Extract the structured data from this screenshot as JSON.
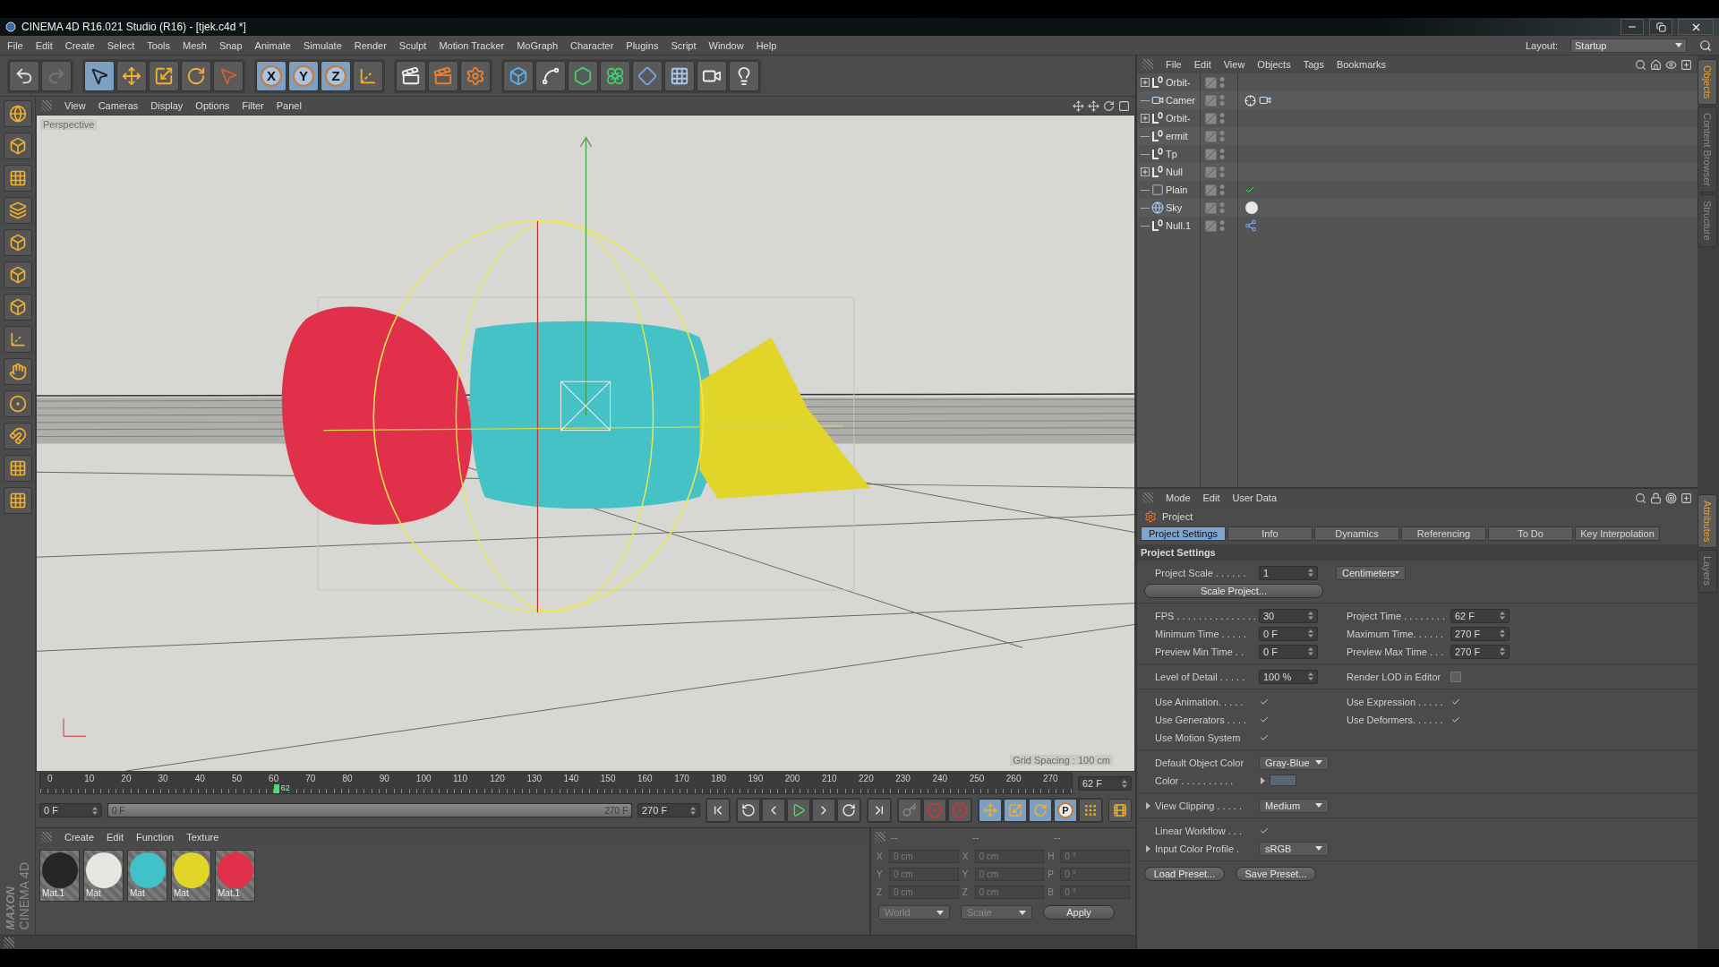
{
  "window": {
    "title": "CINEMA 4D R16.021 Studio (R16) - [tjek.c4d *]"
  },
  "menu": [
    "File",
    "Edit",
    "Create",
    "Select",
    "Tools",
    "Mesh",
    "Snap",
    "Animate",
    "Simulate",
    "Render",
    "Sculpt",
    "Motion Tracker",
    "MoGraph",
    "Character",
    "Plugins",
    "Script",
    "Window",
    "Help"
  ],
  "layout": {
    "label": "Layout:",
    "value": "Startup"
  },
  "toolbar": [
    [
      {
        "kind": "undo",
        "selected": false
      },
      {
        "kind": "redo",
        "selected": false
      }
    ],
    [
      {
        "kind": "select",
        "selected": true
      },
      {
        "kind": "move",
        "selected": false
      },
      {
        "kind": "scale",
        "selected": false
      },
      {
        "kind": "rotate",
        "selected": false
      },
      {
        "kind": "live-select",
        "selected": false
      }
    ],
    [
      {
        "kind": "axis",
        "label": "X",
        "selected": true
      },
      {
        "kind": "axis",
        "label": "Y",
        "selected": true
      },
      {
        "kind": "axis",
        "label": "Z",
        "selected": true
      },
      {
        "kind": "coordinates",
        "selected": false
      }
    ],
    [
      {
        "kind": "render-view",
        "selected": false
      },
      {
        "kind": "render-picture",
        "selected": false
      },
      {
        "kind": "render-settings",
        "selected": false
      }
    ],
    [
      {
        "kind": "cube",
        "selected": false
      },
      {
        "kind": "spline",
        "selected": false
      },
      {
        "kind": "generator",
        "selected": false
      },
      {
        "kind": "array",
        "selected": false
      },
      {
        "kind": "deformer",
        "selected": false
      },
      {
        "kind": "floor",
        "selected": false
      },
      {
        "kind": "camera",
        "selected": false
      },
      {
        "kind": "light",
        "selected": false
      }
    ]
  ],
  "viewport": {
    "menu": [
      "View",
      "Cameras",
      "Display",
      "Options",
      "Filter",
      "Panel"
    ],
    "camera_label": "Perspective",
    "grid_label": "Grid Spacing : 100 cm"
  },
  "timeline": {
    "ticks": [
      "0",
      "10",
      "20",
      "30",
      "40",
      "50",
      "60",
      "70",
      "80",
      "90",
      "100",
      "110",
      "120",
      "130",
      "140",
      "150",
      "160",
      "170",
      "180",
      "190",
      "200",
      "210",
      "220",
      "230",
      "240",
      "250",
      "260",
      "270"
    ],
    "playhead": {
      "label": "62",
      "level": 0.23
    },
    "frame_field": "62 F",
    "start_field": "0 F",
    "range": {
      "start": "0 F",
      "end": "270 F",
      "level": 1
    },
    "end_field": "270 F",
    "key_buttons": [
      {
        "kind": "move",
        "selected": true
      },
      {
        "kind": "scale",
        "selected": true
      },
      {
        "kind": "rotate",
        "selected": true
      },
      {
        "kind": "param",
        "label": "P",
        "selected": true
      },
      {
        "kind": "points",
        "selected": false
      }
    ]
  },
  "materials": {
    "menu": [
      "Create",
      "Edit",
      "Function",
      "Texture"
    ],
    "items": [
      {
        "name": "Mat.1",
        "color": "#262626"
      },
      {
        "name": "Mat",
        "color": "#e8e6e0"
      },
      {
        "name": "Mat",
        "color": "#40c2c8"
      },
      {
        "name": "Mat",
        "color": "#e2d52a"
      },
      {
        "name": "Mat.1",
        "color": "#e0304a"
      }
    ]
  },
  "coordinates": {
    "headers": [
      "--",
      "--",
      "--"
    ],
    "disabled": true,
    "rows": [
      {
        "labels": [
          "X",
          "X",
          "H"
        ],
        "values": [
          "0 cm",
          "0 cm",
          "0 °"
        ]
      },
      {
        "labels": [
          "Y",
          "Y",
          "P"
        ],
        "values": [
          "0 cm",
          "0 cm",
          "0 °"
        ]
      },
      {
        "labels": [
          "Z",
          "Z",
          "B"
        ],
        "values": [
          "0 cm",
          "0 cm",
          "0 °"
        ]
      }
    ],
    "modes": [
      "World",
      "Scale"
    ],
    "apply": "Apply"
  },
  "brand": [
    "MAXON",
    "CINEMA 4D"
  ],
  "objects": {
    "menu": [
      "File",
      "Edit",
      "View",
      "Objects",
      "Tags",
      "Bookmarks"
    ],
    "rows": [
      {
        "name": "Orbit-",
        "kind": "null",
        "expandable": true,
        "tags": []
      },
      {
        "name": "Camer",
        "kind": "camera",
        "expandable": false,
        "tags": [
          {
            "kind": "target"
          },
          {
            "kind": "camera"
          }
        ]
      },
      {
        "name": "Orbit-",
        "kind": "null",
        "expandable": true,
        "tags": []
      },
      {
        "name": "ermit",
        "kind": "null",
        "expandable": false,
        "tags": []
      },
      {
        "name": "Tp",
        "kind": "null",
        "expandable": false,
        "tags": []
      },
      {
        "name": "Null",
        "kind": "null",
        "expandable": true,
        "tags": []
      },
      {
        "name": "Plain",
        "kind": "plane",
        "expandable": false,
        "tags": [
          {
            "kind": "check"
          }
        ]
      },
      {
        "name": "Sky",
        "kind": "sky",
        "expandable": false,
        "tags": [
          {
            "kind": "sky-texture"
          }
        ]
      },
      {
        "name": "Null.1",
        "kind": "null",
        "expandable": false,
        "tags": [
          {
            "kind": "network"
          }
        ]
      }
    ]
  },
  "side_tabs_top": [
    {
      "label": "Objects",
      "selected": true
    },
    {
      "label": "Content Browser",
      "selected": false
    },
    {
      "label": "Structure",
      "selected": false
    }
  ],
  "side_tabs_bottom": [
    {
      "label": "Attributes",
      "selected": true
    },
    {
      "label": "Layers",
      "selected": false
    }
  ],
  "attributes": {
    "menu": [
      "Mode",
      "Edit",
      "User Data"
    ],
    "object": "Project",
    "tabs": [
      {
        "label": "Project Settings",
        "selected": true
      },
      {
        "label": "Info",
        "selected": false
      },
      {
        "label": "Dynamics",
        "selected": false
      },
      {
        "label": "Referencing",
        "selected": false
      },
      {
        "label": "To Do",
        "selected": false
      },
      {
        "label": "Key Interpolation",
        "selected": false
      }
    ],
    "section": "Project Settings",
    "groups": [
      [
        {
          "fields": [
            {
              "label": "Project Scale . . . . . .",
              "kind": "number",
              "value": "1"
            },
            {
              "kind": "dropdown",
              "value": "Centimeters"
            }
          ]
        },
        {
          "fields": [
            {
              "kind": "button",
              "value": "Scale Project..."
            }
          ]
        }
      ],
      [
        {
          "fields": [
            {
              "label": "FPS . . . . . . . . . . . . . . .",
              "kind": "number",
              "value": "30"
            },
            {
              "label": "Project Time . . . . . . . .",
              "kind": "number",
              "value": "62 F"
            }
          ]
        },
        {
          "fields": [
            {
              "label": "Minimum Time . . . . .",
              "kind": "number",
              "value": "0 F"
            },
            {
              "label": "Maximum Time. . . . . .",
              "kind": "number",
              "value": "270 F"
            }
          ]
        },
        {
          "fields": [
            {
              "label": "Preview Min Time . .",
              "kind": "number",
              "value": "0 F"
            },
            {
              "label": "Preview Max Time . . .",
              "kind": "number",
              "value": "270 F"
            }
          ]
        }
      ],
      [
        {
          "fields": [
            {
              "label": "Level of Detail . . . . .",
              "kind": "number",
              "value": "100 %"
            },
            {
              "label": "Render LOD in Editor",
              "kind": "checkbox",
              "checked": false
            }
          ]
        }
      ],
      [
        {
          "fields": [
            {
              "label": "Use Animation. . . . .",
              "kind": "checkbox",
              "checked": true
            },
            {
              "label": "Use Expression . . . . .",
              "kind": "checkbox",
              "checked": true
            }
          ]
        },
        {
          "fields": [
            {
              "label": "Use Generators . . . .",
              "kind": "checkbox",
              "checked": true
            },
            {
              "label": "Use Deformers. . . . . .",
              "kind": "checkbox",
              "checked": true
            }
          ]
        },
        {
          "fields": [
            {
              "label": "Use Motion System",
              "kind": "checkbox",
              "checked": true
            }
          ]
        }
      ],
      [
        {
          "fields": [
            {
              "label": "Default Object Color",
              "kind": "dropdown",
              "value": "Gray-Blue"
            }
          ]
        },
        {
          "fields": [
            {
              "label": "Color . . . . . . . . . .",
              "kind": "color",
              "color": "#5b6670",
              "expanded": false
            }
          ]
        }
      ],
      [
        {
          "fields": [
            {
              "label": "View Clipping . . . . .",
              "kind": "dropdown",
              "value": "Medium",
              "expanded": false
            }
          ]
        }
      ],
      [
        {
          "fields": [
            {
              "label": "Linear Workflow . . .",
              "kind": "checkbox",
              "checked": true
            }
          ]
        },
        {
          "fields": [
            {
              "label": "Input Color Profile .",
              "kind": "dropdown",
              "value": "sRGB",
              "expanded": false
            }
          ]
        }
      ]
    ],
    "buttons": [
      "Load Preset...",
      "Save Preset..."
    ]
  }
}
